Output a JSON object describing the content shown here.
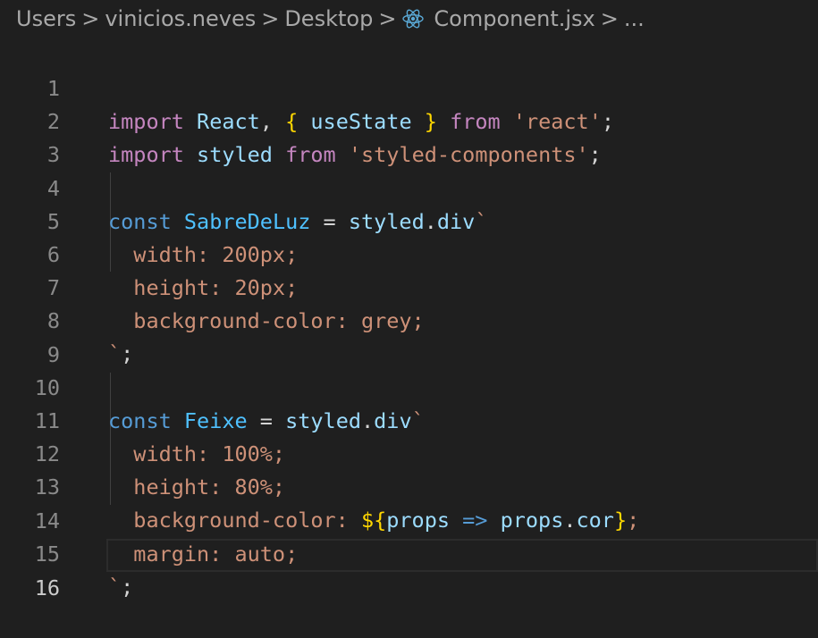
{
  "breadcrumb": {
    "items": [
      "Users",
      "vinicios.neves",
      "Desktop"
    ],
    "file": "Component.jsx",
    "more": "...",
    "separator": ">"
  },
  "editor": {
    "active_line": 16,
    "line_numbers": [
      "1",
      "2",
      "3",
      "4",
      "5",
      "6",
      "7",
      "8",
      "9",
      "10",
      "11",
      "12",
      "13",
      "14",
      "15",
      "16"
    ],
    "lines": {
      "l1": [
        "import",
        " ",
        "React",
        ", ",
        "{",
        " ",
        "useState",
        " ",
        "}",
        " ",
        "from",
        " ",
        "'react'",
        ";"
      ],
      "l2": [
        "import",
        " ",
        "styled",
        " ",
        "from",
        " ",
        "'styled-components'",
        ";"
      ],
      "l4": [
        "const",
        " ",
        "SabreDeLuz",
        " = ",
        "styled",
        ".",
        "div",
        "`"
      ],
      "l5": [
        "  width: 200px;"
      ],
      "l6": [
        "  height: 20px;"
      ],
      "l7": [
        "  background-color: grey;"
      ],
      "l8": [
        "`",
        ";"
      ],
      "l10": [
        "const",
        " ",
        "Feixe",
        " = ",
        "styled",
        ".",
        "div",
        "`"
      ],
      "l11": [
        "  width: 100%;"
      ],
      "l12": [
        "  height: 80%;"
      ],
      "l13": [
        "  background-color: ",
        "${",
        "props",
        " => ",
        "props",
        ".",
        "cor",
        "}",
        ";"
      ],
      "l14": [
        "  margin: auto;"
      ],
      "l15": [
        "`",
        ";"
      ]
    }
  },
  "colors": {
    "background": "#1f1f1f",
    "keyword_import": "#c586c0",
    "keyword_const": "#569cd6",
    "identifier": "#9cdcfe",
    "string": "#ce9178",
    "brace": "#ffd700",
    "line_number": "#8a8a8a"
  }
}
